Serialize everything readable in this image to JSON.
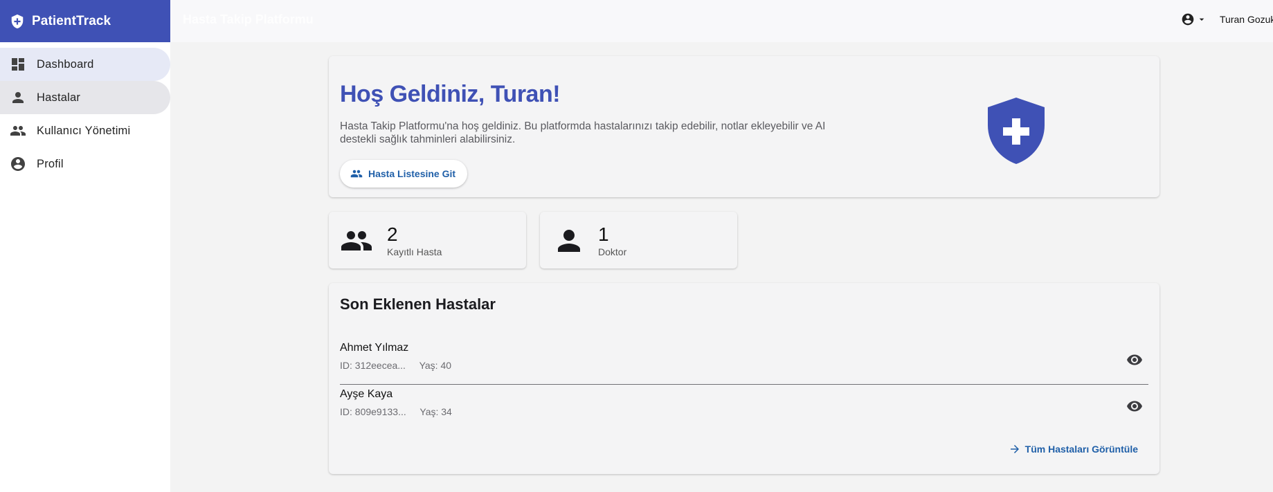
{
  "brand": {
    "name": "PatientTrack"
  },
  "sidebar": {
    "items": [
      {
        "label": "Dashboard",
        "icon": "dashboard-icon"
      },
      {
        "label": "Hastalar",
        "icon": "person-icon"
      },
      {
        "label": "Kullanıcı Yönetimi",
        "icon": "group-icon"
      },
      {
        "label": "Profil",
        "icon": "account-circle-icon"
      }
    ]
  },
  "topbar": {
    "title": "Hasta Takip Platformu",
    "username": "Turan Gozuk"
  },
  "welcome": {
    "title": "Hoş Geldiniz, Turan!",
    "text": "Hasta Takip Platformu'na hoş geldiniz. Bu platformda hastalarınızı takip edebilir, notlar ekleyebilir ve AI destekli sağlık tahminleri alabilirsiniz.",
    "button_label": "Hasta Listesine Git"
  },
  "stats": [
    {
      "value": "2",
      "label": "Kayıtlı Hasta",
      "icon": "group-icon"
    },
    {
      "value": "1",
      "label": "Doktor",
      "icon": "person-icon"
    }
  ],
  "recent": {
    "title": "Son Eklenen Hastalar",
    "patients": [
      {
        "name": "Ahmet Yılmaz",
        "id": "ID: 312eecea...",
        "age": "Yaş: 40"
      },
      {
        "name": "Ayşe Kaya",
        "id": "ID: 809e9133...",
        "age": "Yaş: 34"
      }
    ],
    "view_all_label": "Tüm Hastaları Görüntüle"
  },
  "colors": {
    "primary": "#3f51b5",
    "link": "#1f5fa8",
    "background": "#f3f3f3"
  }
}
